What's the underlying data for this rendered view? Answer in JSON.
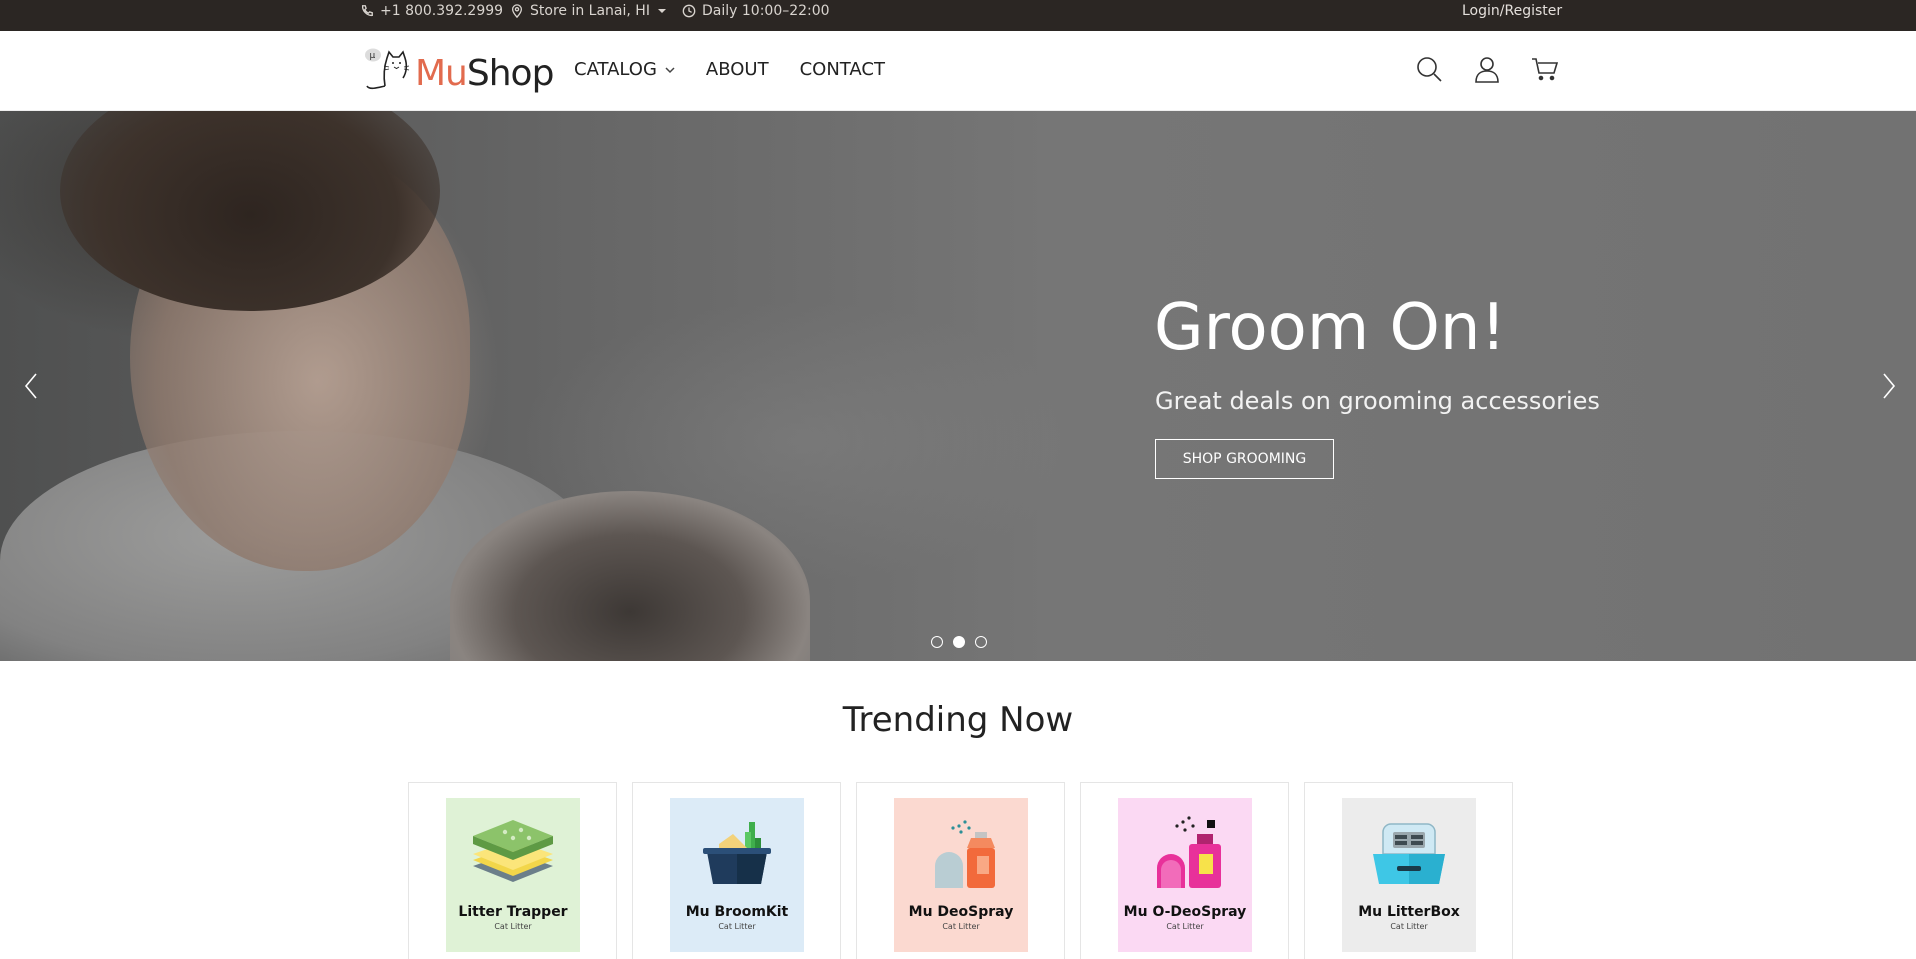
{
  "topbar": {
    "phone": "+1 800.392.2999",
    "store": "Store in Lanai, HI",
    "hours": "Daily 10:00–22:00",
    "login": "Login/Register"
  },
  "header": {
    "logo_mu": "Mu",
    "logo_shop": "Shop",
    "nav": {
      "catalog": "CATALOG",
      "about": "ABOUT",
      "contact": "CONTACT"
    }
  },
  "hero": {
    "title": "Groom On!",
    "subtitle": "Great deals on grooming accessories",
    "cta": "SHOP GROOMING",
    "slides": 3,
    "active_slide": 2
  },
  "trending": {
    "title": "Trending Now",
    "products": [
      {
        "name": "Litter Trapper",
        "category": "Cat Litter",
        "bg": "#dff2d6"
      },
      {
        "name": "Mu BroomKit",
        "category": "Cat Litter",
        "bg": "#dcebf7"
      },
      {
        "name": "Mu DeoSpray",
        "category": "Cat Litter",
        "bg": "#fbd9d0"
      },
      {
        "name": "Mu O-DeoSpray",
        "category": "Cat Litter",
        "bg": "#fbd9f3"
      },
      {
        "name": "Mu LitterBox",
        "category": "Cat Litter",
        "bg": "#ececec"
      }
    ]
  }
}
